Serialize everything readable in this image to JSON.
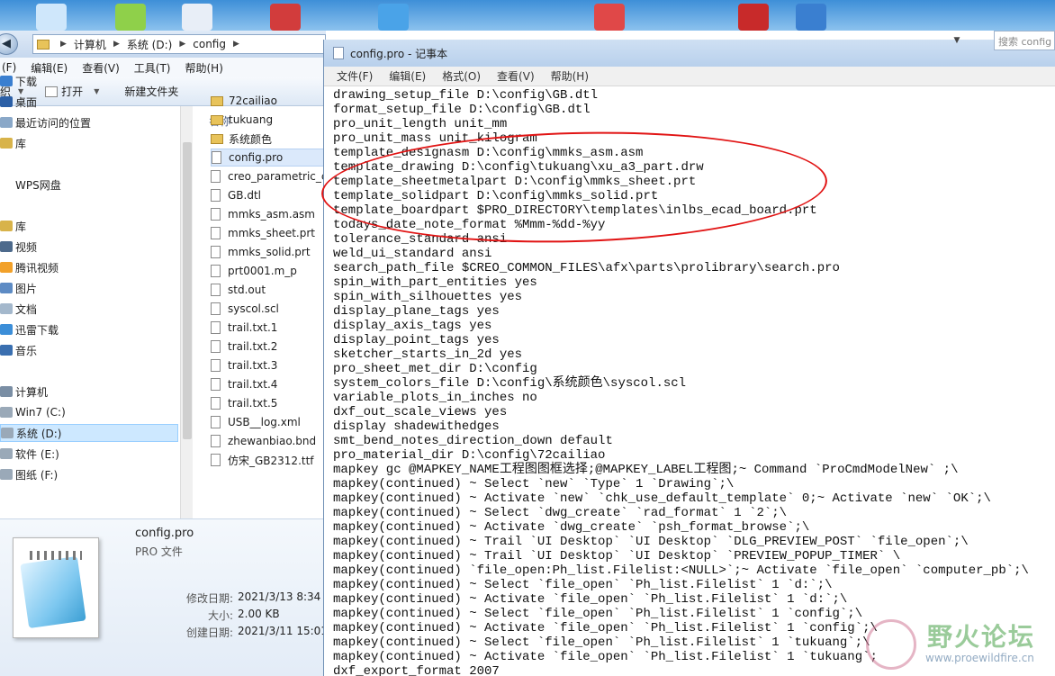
{
  "desktop": {
    "icon_colors": [
      "#cfe7fb",
      "#8fd04a",
      "#e8eef7",
      "#d23c3c",
      "#4aa3e8",
      "#e04848",
      "#c82a2a",
      "#3a7fd0"
    ]
  },
  "explorer": {
    "breadcrumb": [
      "计算机",
      "系统 (D:)",
      "config"
    ],
    "menu": [
      "(F)",
      "编辑(E)",
      "查看(V)",
      "工具(T)",
      "帮助(H)"
    ],
    "toolbar": {
      "left_fragment": "织",
      "open_label": "打开",
      "new_folder_label": "新建文件夹"
    },
    "nav": [
      {
        "label": "下载",
        "icon": "download-folder-icon",
        "color": "#3a7fd0"
      },
      {
        "label": "桌面",
        "icon": "desktop-icon",
        "color": "#2b5fa6"
      },
      {
        "label": "最近访问的位置",
        "icon": "recent-places-icon",
        "color": "#8aa8c8"
      },
      {
        "label": "库",
        "icon": "library-icon",
        "color": "#d8b34a"
      },
      {
        "label": "WPS网盘",
        "icon": "wps-cloud-icon",
        "color": "#ffffff"
      },
      {
        "label": "库",
        "icon": "library-icon",
        "color": "#d8b34a"
      },
      {
        "label": "视频",
        "icon": "videos-icon",
        "color": "#4d6a8c"
      },
      {
        "label": "腾讯视频",
        "icon": "tencent-video-icon",
        "color": "#f2a12a"
      },
      {
        "label": "图片",
        "icon": "pictures-icon",
        "color": "#5d8bc4"
      },
      {
        "label": "文档",
        "icon": "documents-icon",
        "color": "#a4b8cc"
      },
      {
        "label": "迅雷下载",
        "icon": "xunlei-icon",
        "color": "#3c8ed8"
      },
      {
        "label": "音乐",
        "icon": "music-icon",
        "color": "#3a6fb0"
      },
      {
        "label": "计算机",
        "icon": "computer-icon",
        "color": "#7a8ea4"
      },
      {
        "label": "Win7 (C:)",
        "icon": "drive-icon",
        "color": "#9aa9b8"
      },
      {
        "label": "系统 (D:)",
        "icon": "drive-icon",
        "color": "#9aa9b8"
      },
      {
        "label": "软件 (E:)",
        "icon": "drive-icon",
        "color": "#9aa9b8"
      },
      {
        "label": "图纸 (F:)",
        "icon": "drive-icon",
        "color": "#9aa9b8"
      }
    ],
    "column_header": "名称",
    "files": [
      {
        "name": "72cailiao",
        "type": "folder"
      },
      {
        "name": "tukuang",
        "type": "folder"
      },
      {
        "name": "系统颜色",
        "type": "folder"
      },
      {
        "name": "config.pro",
        "type": "file"
      },
      {
        "name": "creo_parametric_c",
        "type": "file"
      },
      {
        "name": "GB.dtl",
        "type": "file"
      },
      {
        "name": "mmks_asm.asm",
        "type": "file"
      },
      {
        "name": "mmks_sheet.prt",
        "type": "file"
      },
      {
        "name": "mmks_solid.prt",
        "type": "file"
      },
      {
        "name": "prt0001.m_p",
        "type": "file"
      },
      {
        "name": "std.out",
        "type": "file"
      },
      {
        "name": "syscol.scl",
        "type": "file"
      },
      {
        "name": "trail.txt.1",
        "type": "file"
      },
      {
        "name": "trail.txt.2",
        "type": "file"
      },
      {
        "name": "trail.txt.3",
        "type": "file"
      },
      {
        "name": "trail.txt.4",
        "type": "file"
      },
      {
        "name": "trail.txt.5",
        "type": "file"
      },
      {
        "name": "USB__log.xml",
        "type": "file"
      },
      {
        "name": "zhewanbiao.bnd",
        "type": "file"
      },
      {
        "name": "仿宋_GB2312.ttf",
        "type": "file"
      }
    ],
    "details": {
      "name": "config.pro",
      "type": "PRO 文件",
      "modified_label": "修改日期:",
      "modified": "2021/3/13 8:34",
      "size_label": "大小:",
      "size": "2.00 KB",
      "created_label": "创建日期:",
      "created": "2021/3/11 15:01"
    }
  },
  "notepad": {
    "title": "config.pro - 记事本",
    "menu": [
      "文件(F)",
      "编辑(E)",
      "格式(O)",
      "查看(V)",
      "帮助(H)"
    ],
    "search_placeholder": "搜索 config",
    "lines": [
      "drawing_setup_file D:\\config\\GB.dtl",
      "format_setup_file D:\\config\\GB.dtl",
      "pro_unit_length unit_mm",
      "pro_unit_mass unit_kilogram",
      "template_designasm D:\\config\\mmks_asm.asm",
      "template_drawing D:\\config\\tukuang\\xu_a3_part.drw",
      "template_sheetmetalpart D:\\config\\mmks_sheet.prt",
      "template_solidpart D:\\config\\mmks_solid.prt",
      "template_boardpart $PRO_DIRECTORY\\templates\\inlbs_ecad_board.prt",
      "todays_date_note_format %Mmm-%dd-%yy",
      "tolerance_standard ansi",
      "weld_ui_standard ansi",
      "search_path_file $CREO_COMMON_FILES\\afx\\parts\\prolibrary\\search.pro",
      "spin_with_part_entities yes",
      "spin_with_silhouettes yes",
      "display_plane_tags yes",
      "display_axis_tags yes",
      "display_point_tags yes",
      "sketcher_starts_in_2d yes",
      "pro_sheet_met_dir D:\\config",
      "system_colors_file D:\\config\\系统颜色\\syscol.scl",
      "variable_plots_in_inches no",
      "dxf_out_scale_views yes",
      "display shadewithedges",
      "smt_bend_notes_direction_down default",
      "pro_material_dir D:\\config\\72cailiao",
      "mapkey gc @MAPKEY_NAME工程图图框选择;@MAPKEY_LABEL工程图;~ Command `ProCmdModelNew` ;\\",
      "mapkey(continued) ~ Select `new` `Type` 1 `Drawing`;\\",
      "mapkey(continued) ~ Activate `new` `chk_use_default_template` 0;~ Activate `new` `OK`;\\",
      "mapkey(continued) ~ Select `dwg_create` `rad_format` 1 `2`;\\",
      "mapkey(continued) ~ Activate `dwg_create` `psh_format_browse`;\\",
      "mapkey(continued) ~ Trail `UI Desktop` `UI Desktop` `DLG_PREVIEW_POST` `file_open`;\\",
      "mapkey(continued) ~ Trail `UI Desktop` `UI Desktop` `PREVIEW_POPUP_TIMER` \\",
      "mapkey(continued) `file_open:Ph_list.Filelist:<NULL>`;~ Activate `file_open` `computer_pb`;\\",
      "mapkey(continued) ~ Select `file_open` `Ph_list.Filelist` 1 `d:`;\\",
      "mapkey(continued) ~ Activate `file_open` `Ph_list.Filelist` 1 `d:`;\\",
      "mapkey(continued) ~ Select `file_open` `Ph_list.Filelist` 1 `config`;\\",
      "mapkey(continued) ~ Activate `file_open` `Ph_list.Filelist` 1 `config`;\\",
      "mapkey(continued) ~ Select `file_open` `Ph_list.Filelist` 1 `tukuang`;\\",
      "mapkey(continued) ~ Activate `file_open` `Ph_list.Filelist` 1 `tukuang`;",
      "dxf_export_format 2007"
    ]
  },
  "watermark": {
    "text": "野火论坛",
    "url": "www.proewildfire.cn"
  },
  "colors": {
    "highlight_circle": "#e11414",
    "selection": "#cde8ff"
  }
}
